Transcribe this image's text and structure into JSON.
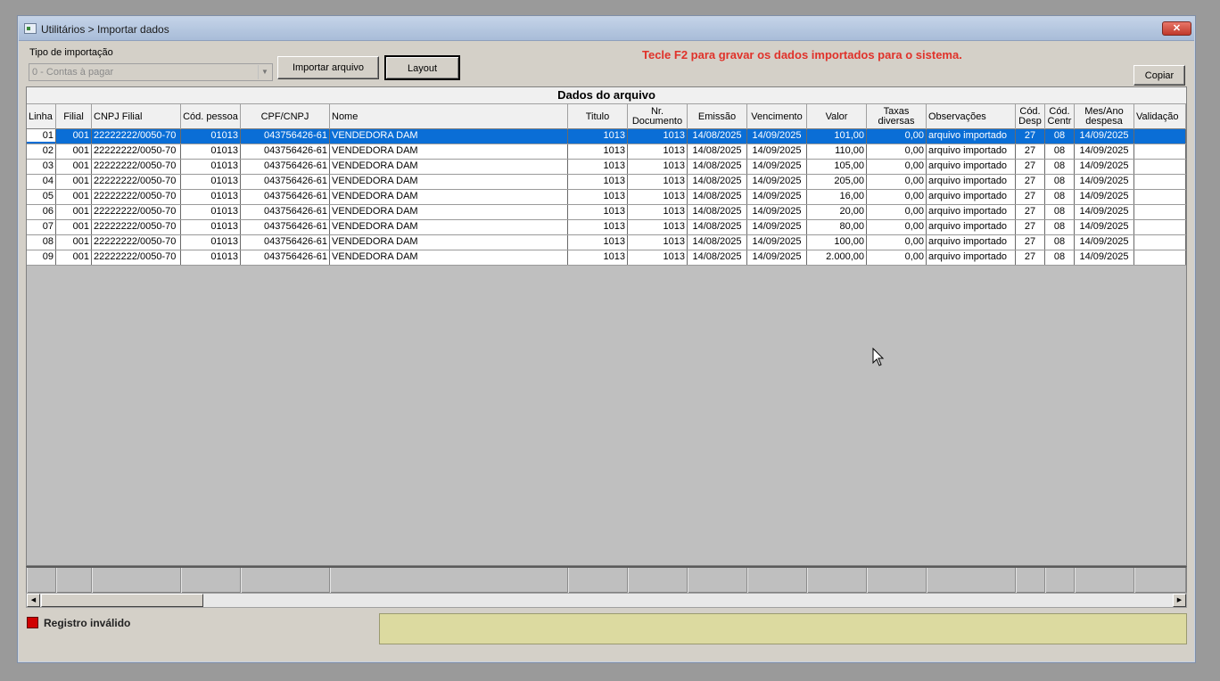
{
  "window": {
    "title": "Utilitários > Importar dados",
    "close_label": "✕"
  },
  "toolbar": {
    "tipo_label": "Tipo de importação",
    "tipo_value": "0 - Contas à pagar",
    "importar_label": "Importar arquivo",
    "layout_label": "Layout",
    "copiar_label": "Copiar",
    "notice": "Tecle F2 para gravar os dados importados para o sistema."
  },
  "grid": {
    "caption": "Dados do arquivo",
    "columns": [
      "Linha",
      "Filial",
      "CNPJ Filial",
      "Cód. pessoa",
      "CPF/CNPJ",
      "Nome",
      "Titulo",
      "Nr. Documento",
      "Emissão",
      "Vencimento",
      "Valor",
      "Taxas diversas",
      "Observações",
      "Cód. Desp",
      "Cód. Centr",
      "Mes/Ano despesa",
      "Validação"
    ],
    "rows": [
      [
        "01",
        "001",
        "22222222/0050-70",
        "01013",
        "043756426-61",
        "VENDEDORA DAM",
        "1013",
        "1013",
        "14/08/2025",
        "14/09/2025",
        "101,00",
        "0,00",
        "arquivo importado",
        "27",
        "08",
        "14/09/2025",
        ""
      ],
      [
        "02",
        "001",
        "22222222/0050-70",
        "01013",
        "043756426-61",
        "VENDEDORA DAM",
        "1013",
        "1013",
        "14/08/2025",
        "14/09/2025",
        "110,00",
        "0,00",
        "arquivo importado",
        "27",
        "08",
        "14/09/2025",
        ""
      ],
      [
        "03",
        "001",
        "22222222/0050-70",
        "01013",
        "043756426-61",
        "VENDEDORA DAM",
        "1013",
        "1013",
        "14/08/2025",
        "14/09/2025",
        "105,00",
        "0,00",
        "arquivo importado",
        "27",
        "08",
        "14/09/2025",
        ""
      ],
      [
        "04",
        "001",
        "22222222/0050-70",
        "01013",
        "043756426-61",
        "VENDEDORA DAM",
        "1013",
        "1013",
        "14/08/2025",
        "14/09/2025",
        "205,00",
        "0,00",
        "arquivo importado",
        "27",
        "08",
        "14/09/2025",
        ""
      ],
      [
        "05",
        "001",
        "22222222/0050-70",
        "01013",
        "043756426-61",
        "VENDEDORA DAM",
        "1013",
        "1013",
        "14/08/2025",
        "14/09/2025",
        "16,00",
        "0,00",
        "arquivo importado",
        "27",
        "08",
        "14/09/2025",
        ""
      ],
      [
        "06",
        "001",
        "22222222/0050-70",
        "01013",
        "043756426-61",
        "VENDEDORA DAM",
        "1013",
        "1013",
        "14/08/2025",
        "14/09/2025",
        "20,00",
        "0,00",
        "arquivo importado",
        "27",
        "08",
        "14/09/2025",
        ""
      ],
      [
        "07",
        "001",
        "22222222/0050-70",
        "01013",
        "043756426-61",
        "VENDEDORA DAM",
        "1013",
        "1013",
        "14/08/2025",
        "14/09/2025",
        "80,00",
        "0,00",
        "arquivo importado",
        "27",
        "08",
        "14/09/2025",
        ""
      ],
      [
        "08",
        "001",
        "22222222/0050-70",
        "01013",
        "043756426-61",
        "VENDEDORA DAM",
        "1013",
        "1013",
        "14/08/2025",
        "14/09/2025",
        "100,00",
        "0,00",
        "arquivo importado",
        "27",
        "08",
        "14/09/2025",
        ""
      ],
      [
        "09",
        "001",
        "22222222/0050-70",
        "01013",
        "043756426-61",
        "VENDEDORA DAM",
        "1013",
        "1013",
        "14/08/2025",
        "14/09/2025",
        "2.000,00",
        "0,00",
        "arquivo importado",
        "27",
        "08",
        "14/09/2025",
        ""
      ]
    ],
    "selected_row": 0
  },
  "legend": {
    "invalid_label": "Registro inválido",
    "invalid_color": "#d00000"
  },
  "colors": {
    "selection": "#0a6ed6",
    "notice": "#e0322a",
    "message_panel": "#dcdaa0"
  }
}
